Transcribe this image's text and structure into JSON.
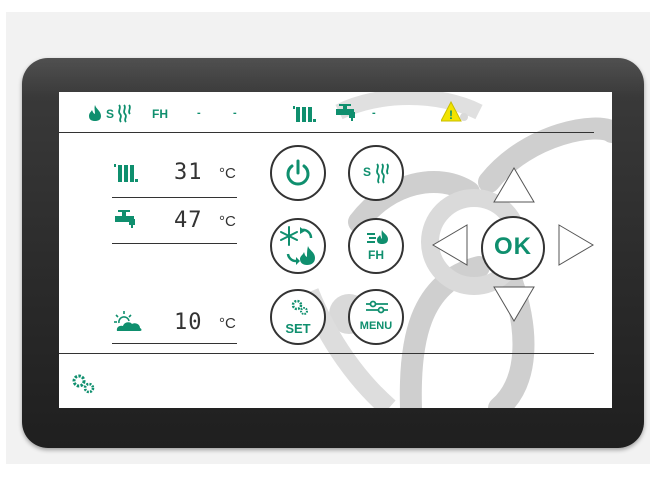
{
  "status_bar": {
    "s_label": "S",
    "fh_label": "FH",
    "dash_1": "-",
    "dash_2": "-",
    "dash_3": "-",
    "warning_mark": "!"
  },
  "readings": [
    {
      "name": "heating",
      "value": "31",
      "unit": "°C"
    },
    {
      "name": "hot-water",
      "value": "47",
      "unit": "°C"
    },
    {
      "name": "outdoor",
      "value": "10",
      "unit": "°C"
    }
  ],
  "buttons": {
    "s_label": "S",
    "fh_label": "FH",
    "set_label": "SET",
    "menu_label": "MENU",
    "ok_label": "OK"
  },
  "colors": {
    "accent": "#0f8f6e",
    "warning": "#f2e400",
    "bezel": "#2b2b2b",
    "logo": "#cfcfcf"
  },
  "icons": [
    "flame-icon",
    "heat-wave-icon",
    "radiator-icon",
    "tap-icon",
    "warning-icon",
    "snowflake-icon",
    "power-icon",
    "settings-icon",
    "sliders-icon",
    "sun-cloud-icon",
    "arrow-up-icon",
    "arrow-down-icon",
    "arrow-left-icon",
    "arrow-right-icon"
  ]
}
